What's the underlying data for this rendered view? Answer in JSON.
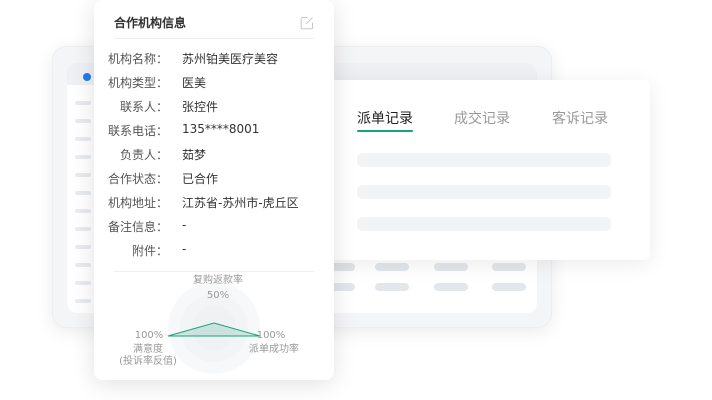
{
  "card": {
    "title": "合作机构信息",
    "fields": [
      {
        "label": "机构名称：",
        "value": "苏州铂美医疗美容"
      },
      {
        "label": "机构类型：",
        "value": "医美"
      },
      {
        "label": "联系人：",
        "value": "张控件"
      },
      {
        "label": "联系电话：",
        "value": "135****8001"
      },
      {
        "label": "负责人：",
        "value": "茹梦"
      },
      {
        "label": "合作状态：",
        "value": "已合作"
      },
      {
        "label": "机构地址：",
        "value": "江苏省-苏州市-虎丘区"
      },
      {
        "label": "备注信息：",
        "value": "-"
      },
      {
        "label": "附件：",
        "value": "-"
      }
    ],
    "radar": {
      "top": {
        "label": "复购返款率",
        "value": "50%",
        "fraction": 0.5
      },
      "left": {
        "value": "100%",
        "label_line1": "满意度",
        "label_line2": "(投诉率反值)",
        "fraction": 1.0
      },
      "right": {
        "value": "100%",
        "label": "派单成功率",
        "fraction": 1.0
      },
      "accent": "#1aa37a"
    }
  },
  "tabs": [
    {
      "label": "派单记录",
      "active": true
    },
    {
      "label": "成交记录",
      "active": false
    },
    {
      "label": "客诉记录",
      "active": false
    }
  ],
  "colors": {
    "accent": "#1aa37a",
    "window_dot": "#1f7cf0"
  },
  "icons": {
    "edit": "edit-icon"
  }
}
